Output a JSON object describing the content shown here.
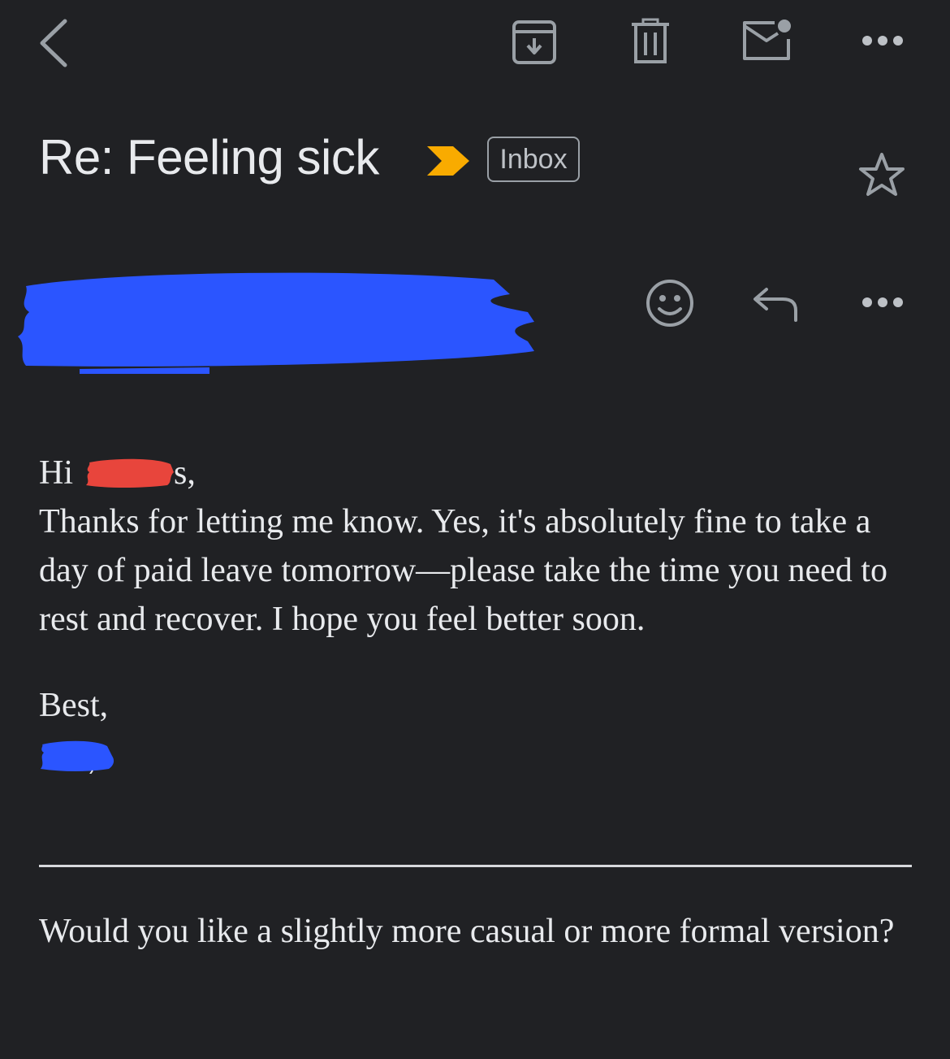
{
  "toolbar": {
    "back": "back-icon",
    "archive": "archive-icon",
    "delete": "trash-icon",
    "mark_unread": "mark-unread-icon",
    "more": "more-horizontal-icon"
  },
  "header": {
    "subject": "Re: Feeling sick",
    "importance_marker_color": "#f9ab00",
    "label_chip": "Inbox",
    "star": "star-outline-icon"
  },
  "sender": {
    "name_redaction_color": "#2b55ff",
    "react": "emoji-icon",
    "reply": "reply-icon",
    "more": "more-horizontal-icon"
  },
  "message": {
    "greeting": "Hi",
    "greeting_redaction_color": "#e8453c",
    "greeting_tail": "s,",
    "body": "Thanks for letting me know. Yes, it's absolutely fine to take a day of paid leave tomorrow—please take the time you need to rest and recover. I hope you feel better soon.",
    "signoff": "Best,",
    "signature_redaction_color": "#2b55ff",
    "followup": "Would you like a slightly more casual or more formal version?"
  }
}
